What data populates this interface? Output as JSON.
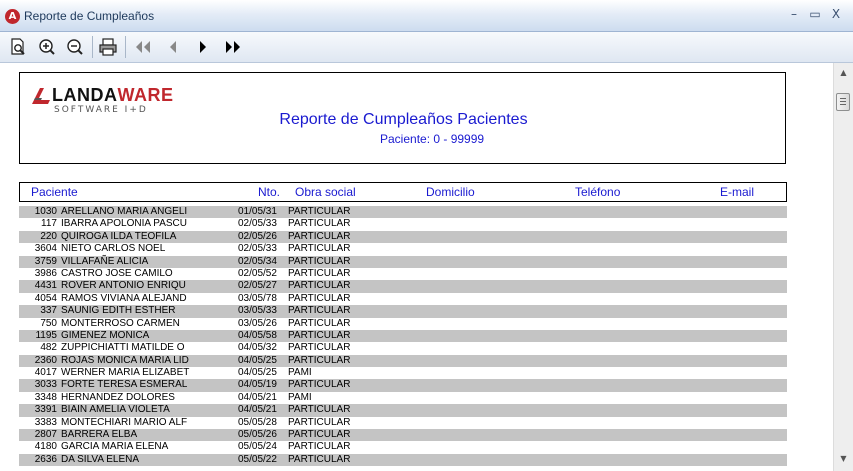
{
  "window": {
    "title": "Reporte de Cumpleaños",
    "minimize": "–",
    "maximize": "▭",
    "close": "X"
  },
  "toolbar": {
    "items": [
      {
        "icon": "page-preview-icon"
      },
      {
        "icon": "zoom-in-icon"
      },
      {
        "icon": "zoom-out-icon"
      },
      {
        "icon": "printer-icon"
      },
      {
        "icon": "first-page-icon"
      },
      {
        "icon": "previous-page-icon"
      },
      {
        "icon": "next-page-icon"
      },
      {
        "icon": "last-page-icon"
      }
    ]
  },
  "logo": {
    "brand_left": "LANDA",
    "brand_right": "WARE",
    "tagline": "SOFTWARE I+D",
    "accent_color": "#c0272d"
  },
  "report": {
    "title": "Reporte de Cumpleaños Pacientes",
    "subtitle": "Paciente: 0 - 99999",
    "text_color": "#1a1ad0"
  },
  "columns": {
    "paciente": "Paciente",
    "nto": "Nto.",
    "obra": "Obra social",
    "domicilio": "Domicilio",
    "telefono": "Teléfono",
    "email": "E-mail"
  },
  "rows": [
    {
      "id": "1030",
      "name": "ARELLANO MARIA ANGELI",
      "date": "01/05/31",
      "obra": "PARTICULAR"
    },
    {
      "id": "117",
      "name": "IBARRA APOLONIA PASCU",
      "date": "02/05/33",
      "obra": "PARTICULAR"
    },
    {
      "id": "220",
      "name": "QUIROGA ILDA TEOFILA",
      "date": "02/05/26",
      "obra": "PARTICULAR"
    },
    {
      "id": "3604",
      "name": "NIETO CARLOS NOEL",
      "date": "02/05/33",
      "obra": "PARTICULAR"
    },
    {
      "id": "3759",
      "name": "VILLAFAÑE ALICIA",
      "date": "02/05/34",
      "obra": "PARTICULAR"
    },
    {
      "id": "3986",
      "name": "CASTRO JOSE CAMILO",
      "date": "02/05/52",
      "obra": "PARTICULAR"
    },
    {
      "id": "4431",
      "name": "ROVER ANTONIO ENRIQU",
      "date": "02/05/27",
      "obra": "PARTICULAR"
    },
    {
      "id": "4054",
      "name": "RAMOS VIVIANA ALEJAND",
      "date": "03/05/78",
      "obra": "PARTICULAR"
    },
    {
      "id": "337",
      "name": "SAUNIG EDITH ESTHER",
      "date": "03/05/33",
      "obra": "PARTICULAR"
    },
    {
      "id": "750",
      "name": "MONTERROSO CARMEN",
      "date": "03/05/26",
      "obra": "PARTICULAR"
    },
    {
      "id": "1195",
      "name": "GIMENEZ MONICA",
      "date": "04/05/58",
      "obra": "PARTICULAR"
    },
    {
      "id": "482",
      "name": "ZUPPICHIATTI MATILDE O",
      "date": "04/05/32",
      "obra": "PARTICULAR"
    },
    {
      "id": "2360",
      "name": "ROJAS MONICA MARIA LID",
      "date": "04/05/25",
      "obra": "PARTICULAR"
    },
    {
      "id": "4017",
      "name": "WERNER MARIA ELIZABET",
      "date": "04/05/25",
      "obra": "PAMI"
    },
    {
      "id": "3033",
      "name": "FORTE TERESA ESMERAL",
      "date": "04/05/19",
      "obra": "PARTICULAR"
    },
    {
      "id": "3348",
      "name": "HERNANDEZ DOLORES",
      "date": "04/05/21",
      "obra": "PAMI"
    },
    {
      "id": "3391",
      "name": "BIAIN AMELIA VIOLETA",
      "date": "04/05/21",
      "obra": "PARTICULAR"
    },
    {
      "id": "3383",
      "name": "MONTECHIARI MARIO ALF",
      "date": "05/05/28",
      "obra": "PARTICULAR"
    },
    {
      "id": "2807",
      "name": "BARRERA ELBA",
      "date": "05/05/26",
      "obra": "PARTICULAR"
    },
    {
      "id": "4180",
      "name": "GARCIA MARIA ELENA",
      "date": "05/05/24",
      "obra": "PARTICULAR"
    },
    {
      "id": "2636",
      "name": "DA SILVA ELENA",
      "date": "05/05/22",
      "obra": "PARTICULAR"
    }
  ]
}
